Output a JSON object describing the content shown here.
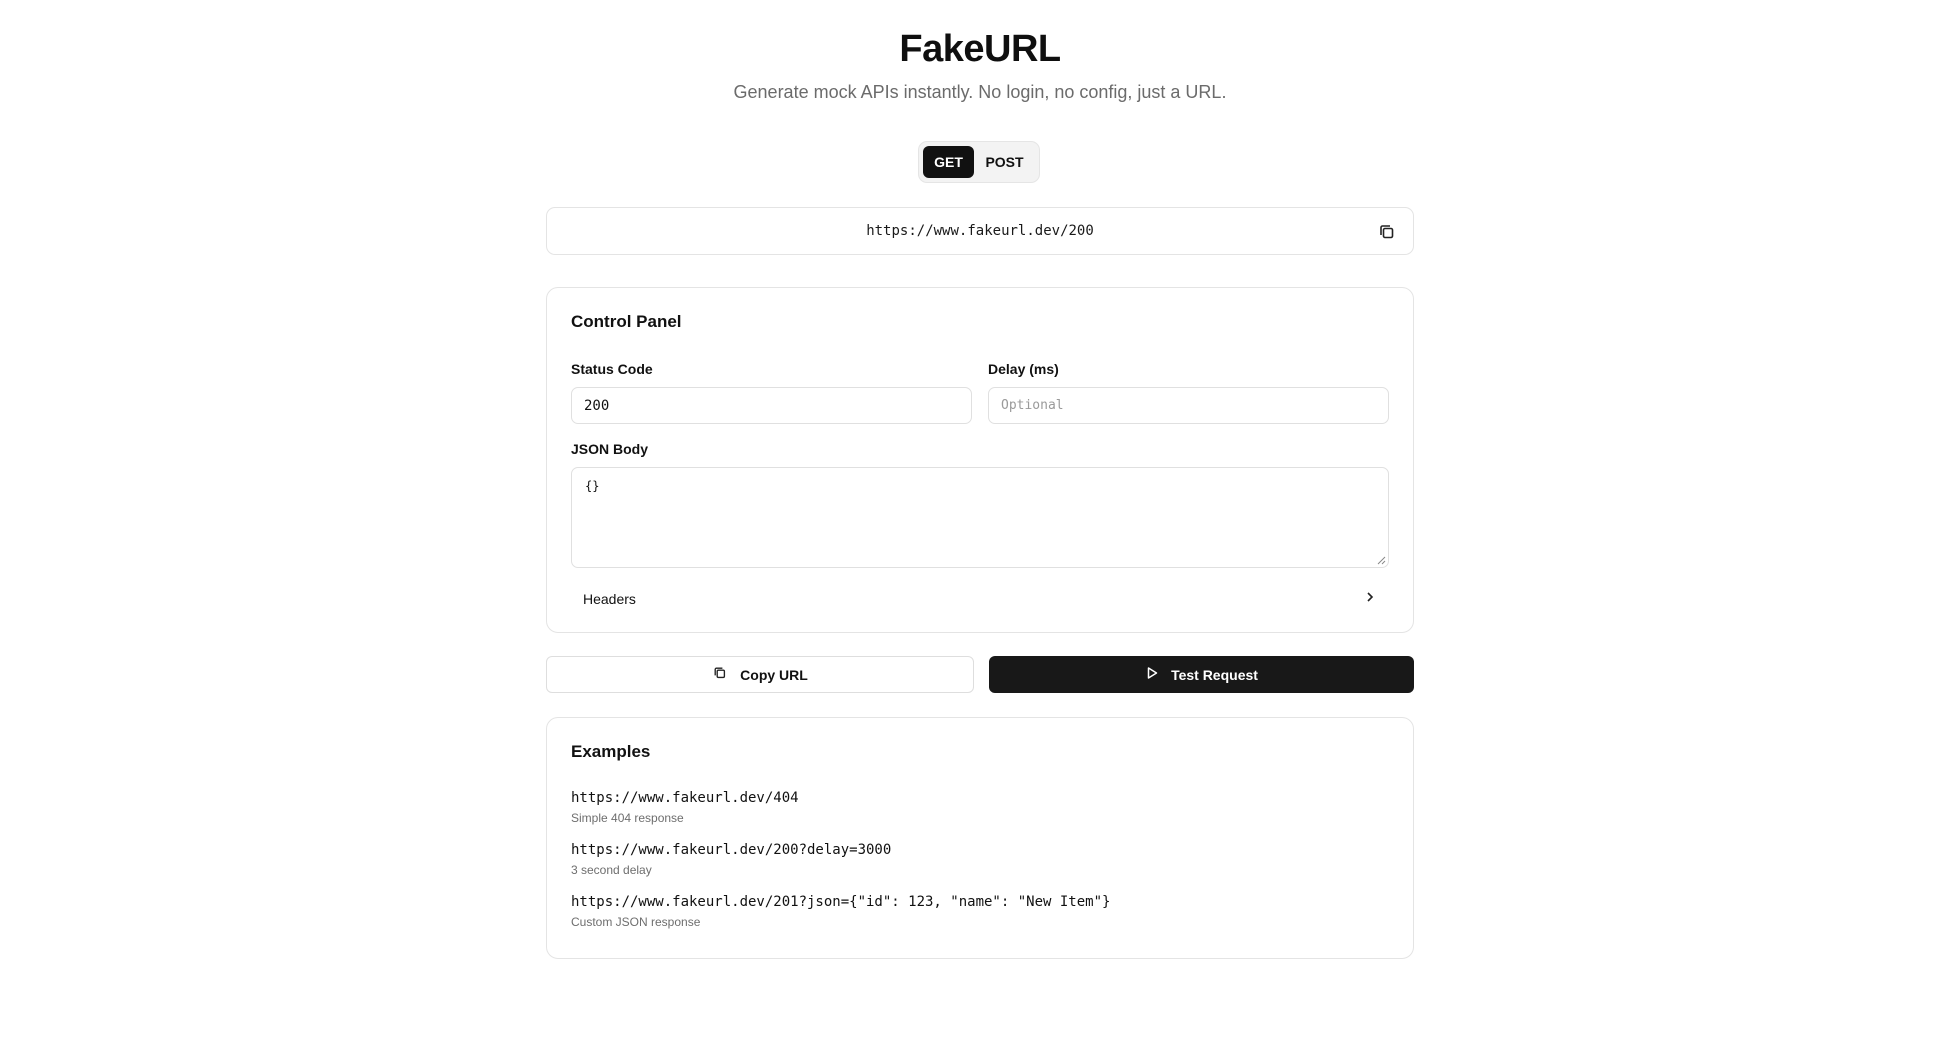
{
  "header": {
    "title": "FakeURL",
    "subtitle": "Generate mock APIs instantly. No login, no config, just a URL."
  },
  "method_toggle": {
    "options": [
      "GET",
      "POST"
    ],
    "selected": "GET"
  },
  "url_bar": {
    "value": "https://www.fakeurl.dev/200",
    "icon": "copy-icon"
  },
  "control_panel": {
    "title": "Control Panel",
    "status_code_label": "Status Code",
    "status_code_value": "200",
    "delay_label": "Delay (ms)",
    "delay_placeholder": "Optional",
    "json_body_label": "JSON Body",
    "json_body_value": "{}",
    "headers_label": "Headers",
    "headers_icon": "chevron-right-icon"
  },
  "actions": {
    "copy_label": "Copy URL",
    "copy_icon": "copy-icon",
    "test_label": "Test Request",
    "test_icon": "play-icon"
  },
  "examples": {
    "title": "Examples",
    "items": [
      {
        "url": "https://www.fakeurl.dev/404",
        "description": "Simple 404 response"
      },
      {
        "url": "https://www.fakeurl.dev/200?delay=3000",
        "description": "3 second delay"
      },
      {
        "url": "https://www.fakeurl.dev/201?json={\"id\": 123, \"name\": \"New Item\"}",
        "description": "Custom JSON response"
      }
    ]
  },
  "colors": {
    "primary": "#111111",
    "muted_text": "#6b6b6b",
    "border": "#e4e4e4",
    "toggle_bg": "#f3f3f3"
  }
}
